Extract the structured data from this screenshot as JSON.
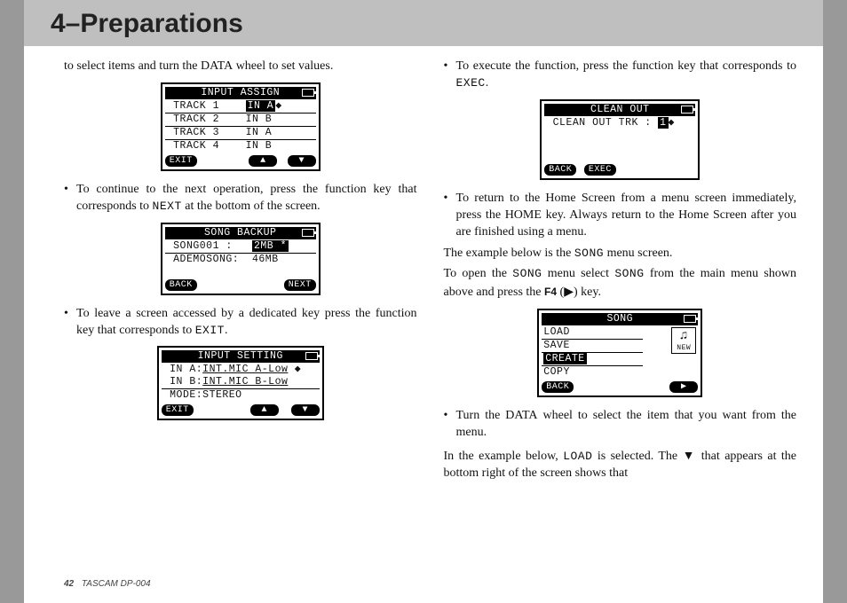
{
  "header": {
    "title": "4–Preparations"
  },
  "footer": {
    "page_number": "42",
    "product": "TASCAM  DP-004"
  },
  "inline": {
    "data_wheel": "DATA",
    "next": "NEXT",
    "exit": "EXIT",
    "exec": "EXEC",
    "home": "HOME",
    "song": "SONG",
    "f4": "F4",
    "load": "LOAD",
    "play_tri": "▶",
    "down_tri": "▼"
  },
  "left": {
    "intro": "to select items and turn the ",
    "intro2": " wheel to set values.",
    "b1a": "To continue to the next operation, press the function key that corresponds to ",
    "b1b": " at the bottom of the screen.",
    "b2a": "To leave a screen accessed by a dedicated key press the function key that corresponds to ",
    "b2b": "."
  },
  "right": {
    "b1a": "To execute the function, press the function key that corresponds to ",
    "b1b": ".",
    "b2a": "To return to the Home Screen from a menu screen immediately, press the ",
    "b2b": " key. Always return to the Home Screen after you are finished using a menu.",
    "p1a": "The example below is the ",
    "p1b": " menu screen.",
    "p2a": "To open the ",
    "p2b": " menu select ",
    "p2c": " from the main menu shown above and press the ",
    "p2d": " (",
    "p2e": ") key.",
    "b3a": "Turn the ",
    "b3b": " wheel to select the item that you want from the menu.",
    "p3a": "In the example below, ",
    "p3b": " is selected. The ",
    "p3c": " that appears at the bottom right of the screen shows that"
  },
  "lcd_input_assign": {
    "title": "INPUT ASSIGN",
    "rows": [
      {
        "label": "TRACK 1",
        "value": "IN A"
      },
      {
        "label": "TRACK 2",
        "value": "IN B"
      },
      {
        "label": "TRACK 3",
        "value": "IN A"
      },
      {
        "label": "TRACK 4",
        "value": "IN B"
      }
    ],
    "btn_left": "EXIT",
    "btn_mid1": "▲",
    "btn_mid2": "▼"
  },
  "lcd_song_backup": {
    "title": "SONG BACKUP",
    "rows": [
      {
        "label": "SONG001 :",
        "value": "2MB *"
      },
      {
        "label": "ADEMOSONG:",
        "value": "46MB"
      }
    ],
    "btn_left": "BACK",
    "btn_right": "NEXT"
  },
  "lcd_input_setting": {
    "title": "INPUT SETTING",
    "rowA_label": "IN A:",
    "rowA_value": "INT.MIC A-Low",
    "rowB_label": "IN B:",
    "rowB_value": "INT.MIC B-Low",
    "mode": "MODE:STEREO",
    "btn_left": "EXIT",
    "btn_mid1": "▲",
    "btn_mid2": "▼"
  },
  "lcd_clean_out": {
    "title": "CLEAN OUT",
    "row": "CLEAN OUT TRK :",
    "row_val": "1",
    "btn_left": "BACK",
    "btn_mid": "EXEC"
  },
  "lcd_song_menu": {
    "title": "SONG",
    "items": [
      "LOAD",
      "SAVE",
      "CREATE",
      "COPY"
    ],
    "icon_caption": "NEW",
    "btn_left": "BACK",
    "btn_right": "▶"
  }
}
